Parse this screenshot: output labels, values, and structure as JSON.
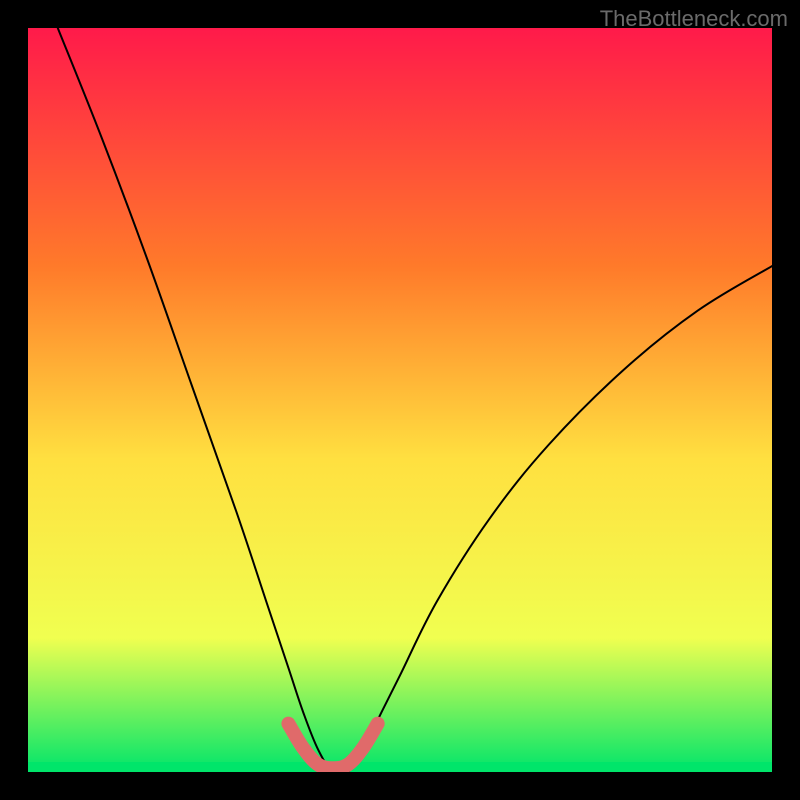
{
  "watermark": {
    "text": "TheBottleneck.com"
  },
  "chart_data": {
    "type": "line",
    "title": "",
    "xlabel": "",
    "ylabel": "",
    "xlim": [
      0,
      100
    ],
    "ylim": [
      0,
      100
    ],
    "grid": false,
    "background_gradient": {
      "top": "#ff1a4a",
      "mid_upper": "#ff7a2a",
      "mid": "#ffe040",
      "mid_lower": "#f0ff50",
      "bottom": "#00e56a"
    },
    "series": [
      {
        "name": "bottleneck-curve",
        "description": "Black V-shaped curve dipping to bottom near x≈42",
        "color": "#000000",
        "stroke_width": 2,
        "x": [
          4,
          10,
          16,
          22,
          28,
          32,
          35,
          37,
          39,
          41,
          43,
          45,
          47,
          50,
          55,
          62,
          70,
          80,
          90,
          100
        ],
        "values": [
          100,
          85,
          69,
          52,
          35,
          23,
          14,
          8,
          3,
          0,
          0,
          3,
          7,
          13,
          23,
          34,
          44,
          54,
          62,
          68
        ]
      },
      {
        "name": "bottom-marker",
        "description": "Salmon rounded segment at curve minimum",
        "color": "#e06a6a",
        "stroke_width": 14,
        "x": [
          35,
          37,
          39,
          41,
          43,
          45,
          47
        ],
        "values": [
          6.5,
          3.2,
          1,
          0.5,
          1,
          3.2,
          6.5
        ]
      }
    ]
  }
}
